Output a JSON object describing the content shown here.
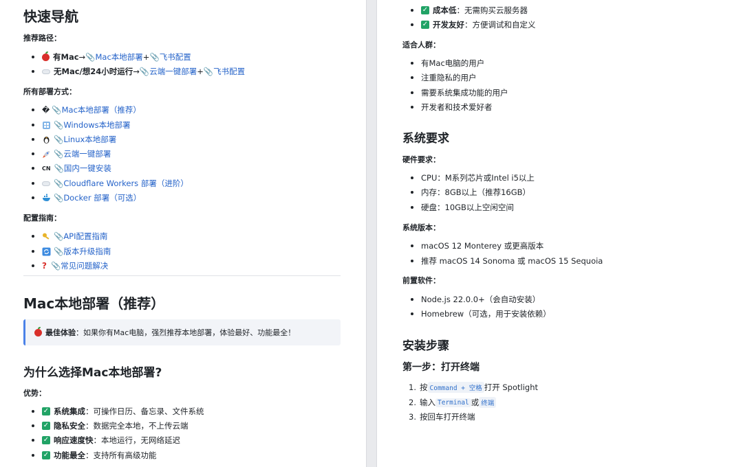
{
  "left": {
    "title": "快速导航",
    "recommend_label": "推荐路径：",
    "recommend": [
      {
        "prefix": "有Mac",
        "arrow": " → ",
        "link1": "📎Mac本地部署",
        "sep": " + ",
        "link2": "📎飞书配置"
      },
      {
        "prefix": "无Mac/想24小时运行",
        "arrow": " → ",
        "link1": "📎云端一键部署",
        "sep": " + ",
        "link2": "📎飞书配置"
      }
    ],
    "all_label": "所有部署方式：",
    "all": [
      {
        "icon": "�",
        "text": "📎Mac本地部署（推荐）"
      },
      {
        "icon": "windows-icon",
        "text": "📎Windows本地部署"
      },
      {
        "icon": "penguin-icon",
        "text": "📎Linux本地部署"
      },
      {
        "icon": "rocket-icon",
        "text": "📎云端一键部署"
      },
      {
        "icon": "CN",
        "text": "📎国内一键安装"
      },
      {
        "icon": "cloud-icon",
        "text": "📎Cloudflare Workers 部署（进阶）"
      },
      {
        "icon": "whale-icon",
        "text": "📎Docker 部署（可选）"
      }
    ],
    "config_label": "配置指南：",
    "config": [
      {
        "icon": "key-icon",
        "text": "📎API配置指南"
      },
      {
        "icon": "refresh-icon",
        "text": "📎版本升级指南"
      },
      {
        "icon": "question-icon",
        "text": "📎常见问题解决"
      }
    ],
    "mac_title": "Mac本地部署（推荐）",
    "callout_bold": "最佳体验",
    "callout_text": "：如果你有Mac电脑，强烈推荐本地部署，体验最好、功能最全！",
    "why_title": "为什么选择Mac本地部署?",
    "adv_label": "优势：",
    "adv": [
      {
        "bold": "系统集成",
        "text": "：可操作日历、备忘录、文件系统"
      },
      {
        "bold": "隐私安全",
        "text": "：数据完全本地，不上传云端"
      },
      {
        "bold": "响应速度快",
        "text": "：本地运行，无网络延迟"
      },
      {
        "bold": "功能最全",
        "text": "：支持所有高级功能"
      }
    ]
  },
  "right": {
    "cont": [
      {
        "bold": "成本低",
        "text": "：无需购买云服务器"
      },
      {
        "bold": "开发友好",
        "text": "：方便调试和自定义"
      }
    ],
    "users_label": "适合人群：",
    "users": [
      "有Mac电脑的用户",
      "注重隐私的用户",
      "需要系统集成功能的用户",
      "开发者和技术爱好者"
    ],
    "sys_title": "系统要求",
    "hw_label": "硬件要求：",
    "hw": [
      "CPU：M系列芯片或Intel i5以上",
      "内存：8GB以上（推荐16GB）",
      "硬盘：10GB以上空闲空间"
    ],
    "os_label": "系统版本：",
    "os": [
      "macOS 12 Monterey 或更高版本",
      "推荐 macOS 14 Sonoma 或 macOS 15 Sequoia"
    ],
    "pre_label": "前置软件：",
    "pre": [
      "Node.js 22.0.0+（会自动安装）",
      "Homebrew（可选，用于安装依赖）"
    ],
    "install_title": "安装步骤",
    "step1_title": "第一步：打开终端",
    "steps": [
      {
        "n": "1.",
        "a": "按 ",
        "code": "Command + 空格",
        "b": " 打开 Spotlight"
      },
      {
        "n": "2.",
        "a": "输入 ",
        "code": "Terminal",
        "mid": " 或 ",
        "code2": "终端"
      },
      {
        "n": "3.",
        "a": "按回车打开终端"
      }
    ]
  },
  "colors": {
    "link": "#2563c9",
    "check": "#21a366",
    "callout_border": "#4b82e8"
  }
}
